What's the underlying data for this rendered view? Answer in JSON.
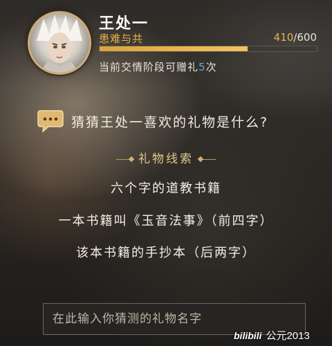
{
  "profile": {
    "name": "王处一",
    "relation": "患难与共",
    "affinity_current": "410",
    "affinity_sep": "/",
    "affinity_max": "600",
    "affinity_fraction": 0.683,
    "gift_prefix": "当前交情阶段可赠礼",
    "gift_count": "5",
    "gift_suffix": "次"
  },
  "quiz": {
    "question": "猜猜王处一喜欢的礼物是什么?",
    "clues_title": "礼物线索",
    "clues": [
      "六个字的道教书籍",
      "一本书籍叫《玉音法事》（前四字）",
      "该本书籍的手抄本（后两字）"
    ],
    "input_placeholder": "在此输入你猜测的礼物名字"
  },
  "watermark": {
    "logo": "bilibili",
    "text": "公元2013"
  },
  "colors": {
    "accent_gold": "#e2b34a",
    "count_blue": "#6fa4e6",
    "clue_title": "#e1c98c"
  },
  "icons": {
    "avatar": "character-portrait",
    "question": "speech-bubble-icon"
  }
}
